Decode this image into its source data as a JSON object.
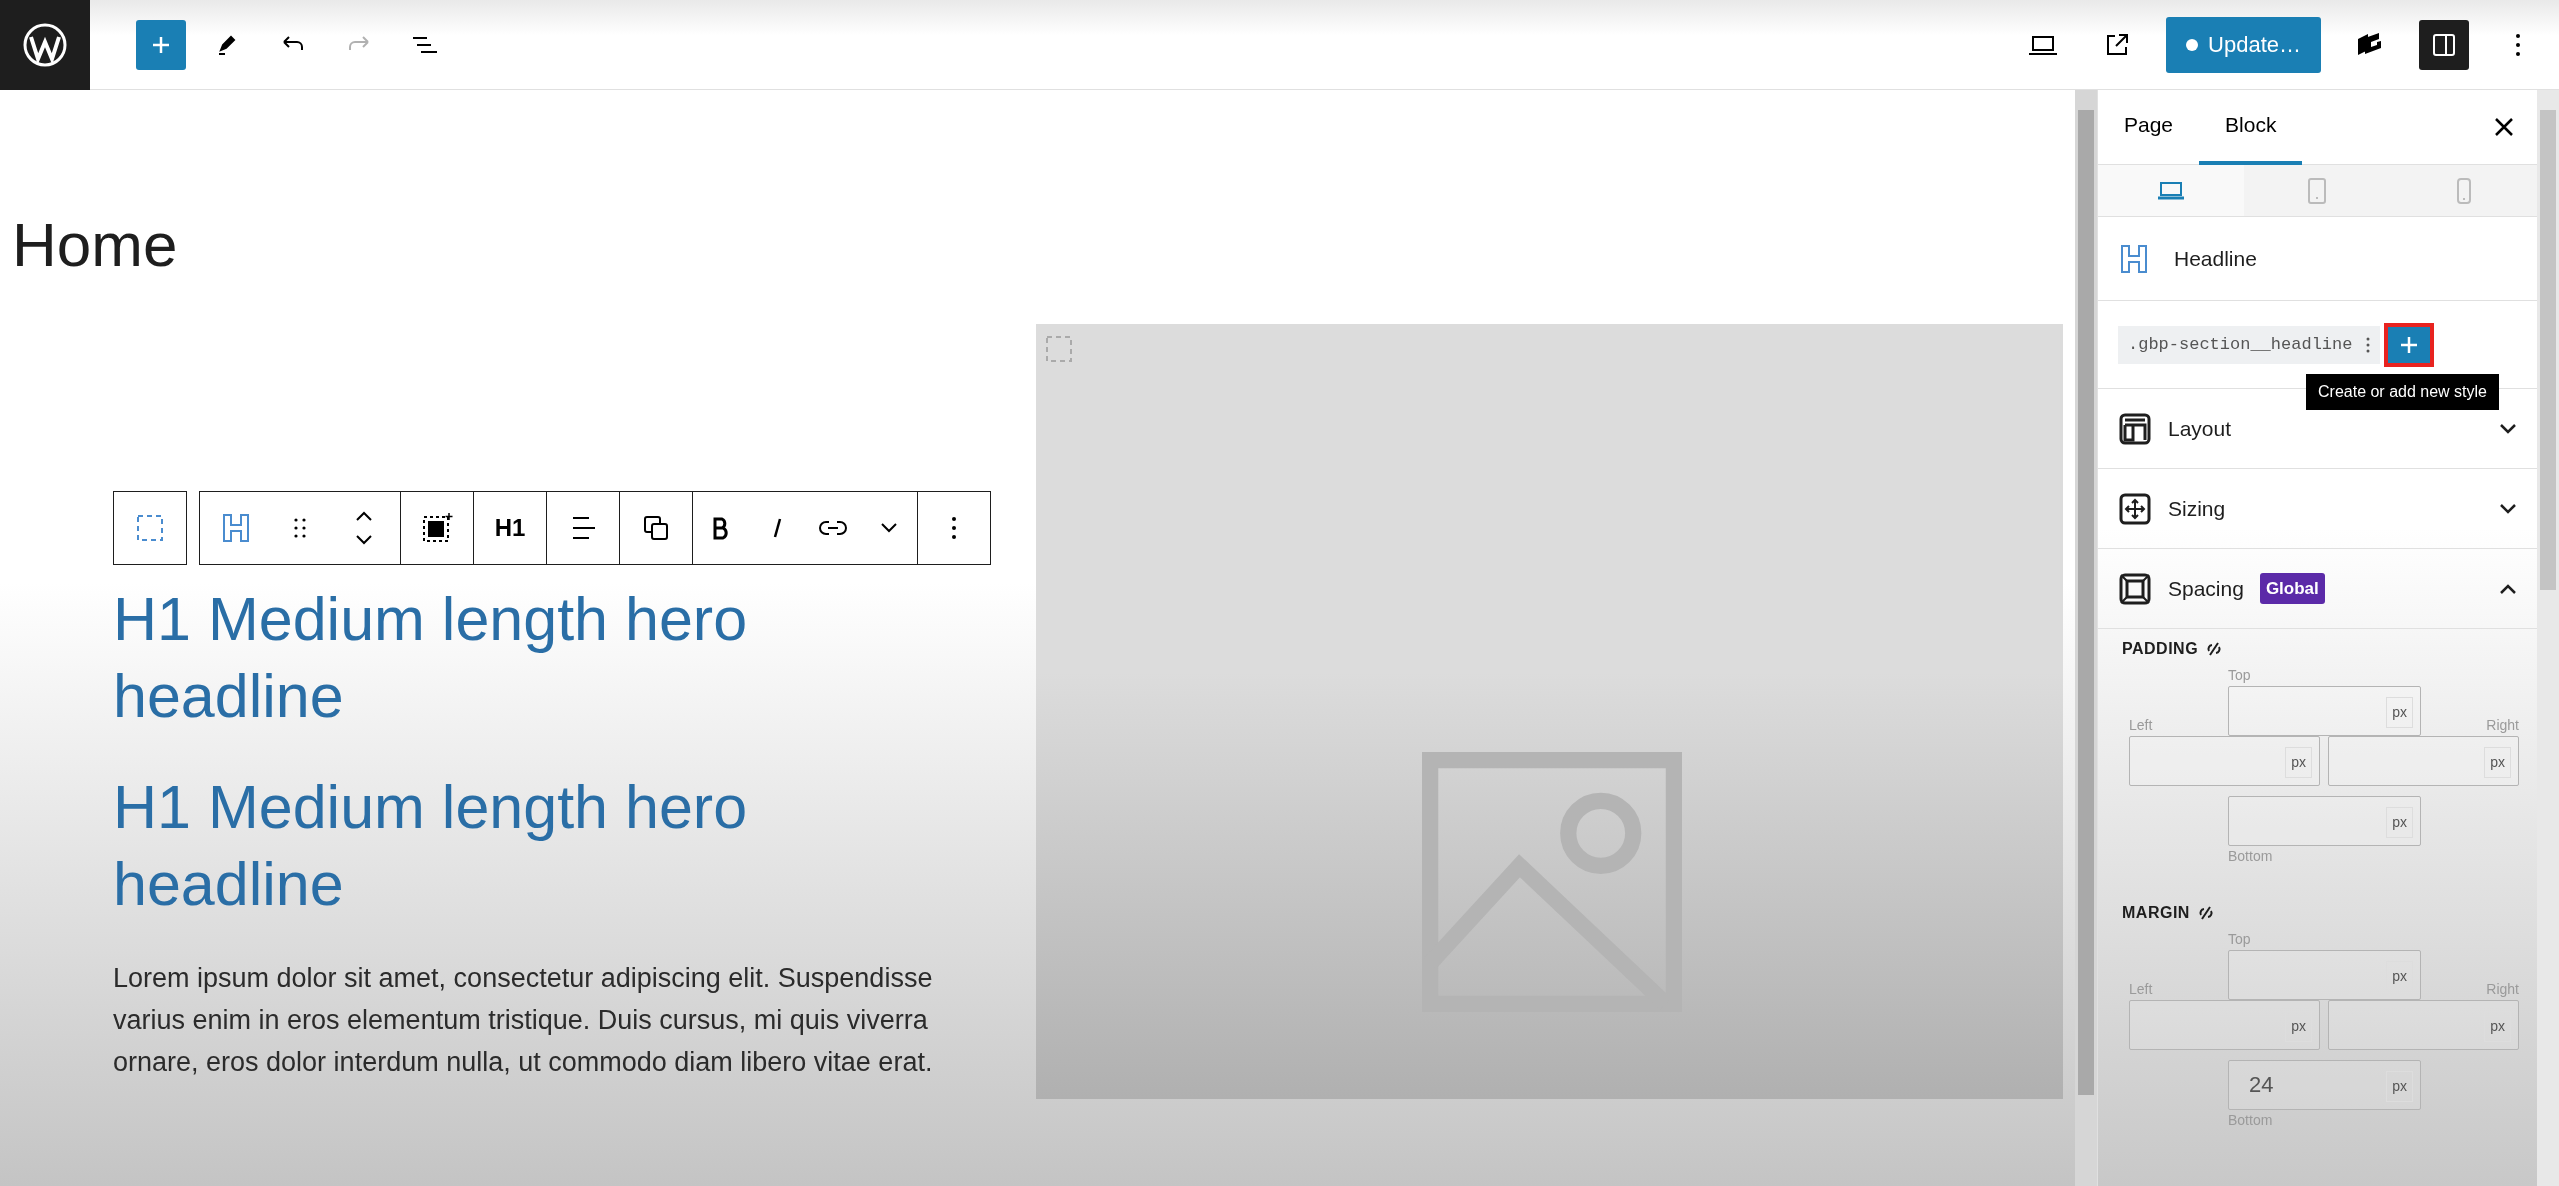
{
  "top_toolbar": {
    "left_tools": [
      {
        "kind": "inserter",
        "disabled": false
      },
      {
        "kind": "tools",
        "disabled": false
      },
      {
        "kind": "undo",
        "disabled": false
      },
      {
        "kind": "redo",
        "disabled": true
      },
      {
        "kind": "list-view",
        "disabled": false
      }
    ],
    "right_tools": [
      {
        "kind": "preview",
        "pressed": false
      },
      {
        "kind": "view-page",
        "pressed": false
      },
      {
        "kind": "publish",
        "label": "Update…",
        "pressed": false
      },
      {
        "kind": "generateblocks",
        "pressed": false
      },
      {
        "kind": "settings",
        "pressed": true
      },
      {
        "kind": "options",
        "pressed": false
      }
    ]
  },
  "block_toolbar": {
    "groups": [
      [
        {
          "kind": "select-parent"
        }
      ],
      [
        {
          "kind": "block-type"
        },
        {
          "kind": "drag"
        },
        {
          "kind": "move"
        }
      ],
      [
        {
          "kind": "container"
        }
      ],
      [
        {
          "kind": "heading-level",
          "label": "H1"
        }
      ],
      [
        {
          "kind": "align"
        }
      ],
      [
        {
          "kind": "duplicate"
        }
      ],
      [
        {
          "kind": "bold"
        },
        {
          "kind": "italic"
        },
        {
          "kind": "link"
        },
        {
          "kind": "more"
        }
      ],
      [
        {
          "kind": "options"
        }
      ]
    ]
  },
  "canvas": {
    "page_title": "Home",
    "headlines": [
      "H1 Medium length hero headline",
      "H1 Medium length hero headline"
    ],
    "paragraph": "Lorem ipsum dolor sit amet, consectetur adipiscing elit. Suspendisse varius enim in eros elementum tristique. Duis cursus, mi quis viverra ornare, eros dolor interdum nulla, ut commodo diam libero vitae erat."
  },
  "sidebar": {
    "tabs": [
      {
        "label": "Page",
        "selected": false
      },
      {
        "label": "Block",
        "selected": true
      }
    ],
    "device_tabs": [
      {
        "kind": "desktop",
        "selected": true
      },
      {
        "kind": "tablet",
        "selected": false
      },
      {
        "kind": "mobile",
        "selected": false
      }
    ],
    "block_name": "Headline",
    "class_chip": ".gbp-section__headline",
    "add_style_button": {
      "highlighted": true
    },
    "tooltip": "Create or add new style",
    "panels": [
      {
        "kind": "layout",
        "label": "Layout",
        "expanded": false
      },
      {
        "kind": "sizing",
        "label": "Sizing",
        "expanded": false
      },
      {
        "kind": "spacing",
        "label": "Spacing",
        "badge": "Global",
        "expanded": true
      }
    ],
    "spacing_groups": [
      {
        "label": "PADDING",
        "fields": [
          {
            "label": "Top",
            "unit": "px"
          },
          {
            "label": "Left",
            "unit": "px"
          },
          {
            "label": "Right",
            "unit": "px"
          },
          {
            "label": "Bottom",
            "unit": "px"
          }
        ]
      },
      {
        "label": "MARGIN",
        "fields": [
          {
            "label": "Top",
            "unit": "px"
          },
          {
            "label": "Left",
            "unit": "px"
          },
          {
            "label": "Right",
            "unit": "px"
          },
          {
            "label": "Bottom",
            "unit": "px",
            "value": "24"
          }
        ]
      }
    ]
  }
}
